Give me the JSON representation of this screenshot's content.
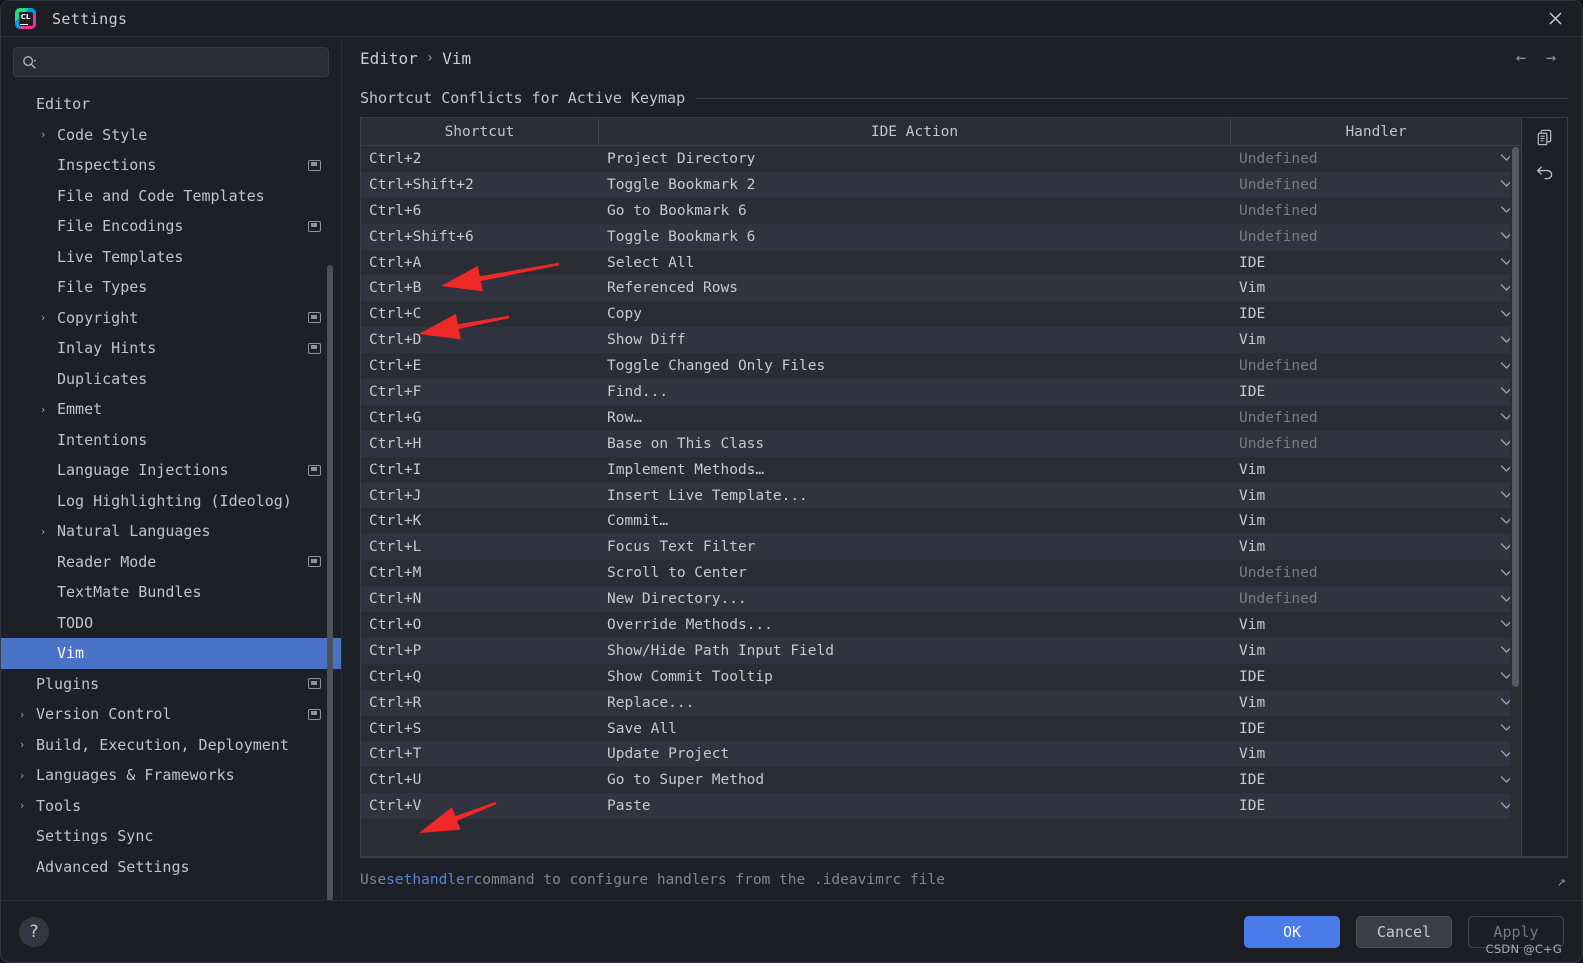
{
  "window": {
    "title": "Settings",
    "app_icon": "clion-icon",
    "close_icon": "close-icon"
  },
  "search": {
    "placeholder": "",
    "value": "",
    "icon": "search-icon"
  },
  "sidebar": {
    "root_label": "Editor",
    "items": [
      {
        "label": "Code Style",
        "level": 1,
        "expandable": true,
        "badge": false
      },
      {
        "label": "Inspections",
        "level": 1,
        "expandable": false,
        "badge": true
      },
      {
        "label": "File and Code Templates",
        "level": 1,
        "expandable": false,
        "badge": false
      },
      {
        "label": "File Encodings",
        "level": 1,
        "expandable": false,
        "badge": true
      },
      {
        "label": "Live Templates",
        "level": 1,
        "expandable": false,
        "badge": false
      },
      {
        "label": "File Types",
        "level": 1,
        "expandable": false,
        "badge": false
      },
      {
        "label": "Copyright",
        "level": 1,
        "expandable": true,
        "badge": true
      },
      {
        "label": "Inlay Hints",
        "level": 1,
        "expandable": false,
        "badge": true
      },
      {
        "label": "Duplicates",
        "level": 1,
        "expandable": false,
        "badge": false
      },
      {
        "label": "Emmet",
        "level": 1,
        "expandable": true,
        "badge": false
      },
      {
        "label": "Intentions",
        "level": 1,
        "expandable": false,
        "badge": false
      },
      {
        "label": "Language Injections",
        "level": 1,
        "expandable": false,
        "badge": true
      },
      {
        "label": "Log Highlighting (Ideolog)",
        "level": 1,
        "expandable": false,
        "badge": false
      },
      {
        "label": "Natural Languages",
        "level": 1,
        "expandable": true,
        "badge": false
      },
      {
        "label": "Reader Mode",
        "level": 1,
        "expandable": false,
        "badge": true
      },
      {
        "label": "TextMate Bundles",
        "level": 1,
        "expandable": false,
        "badge": false
      },
      {
        "label": "TODO",
        "level": 1,
        "expandable": false,
        "badge": false
      },
      {
        "label": "Vim",
        "level": 1,
        "expandable": false,
        "badge": false,
        "selected": true
      },
      {
        "label": "Plugins",
        "level": 0,
        "expandable": false,
        "badge": true
      },
      {
        "label": "Version Control",
        "level": 0,
        "expandable": true,
        "badge": true
      },
      {
        "label": "Build, Execution, Deployment",
        "level": 0,
        "expandable": true,
        "badge": false
      },
      {
        "label": "Languages & Frameworks",
        "level": 0,
        "expandable": true,
        "badge": false
      },
      {
        "label": "Tools",
        "level": 0,
        "expandable": true,
        "badge": false
      },
      {
        "label": "Settings Sync",
        "level": 0,
        "expandable": false,
        "badge": false
      },
      {
        "label": "Advanced Settings",
        "level": 0,
        "expandable": false,
        "badge": false
      }
    ]
  },
  "breadcrumb": {
    "parent": "Editor",
    "separator": "›",
    "current": "Vim",
    "back_icon": "arrow-left-icon",
    "forward_icon": "arrow-right-icon"
  },
  "main": {
    "section_title": "Shortcut Conflicts for Active Keymap",
    "columns": [
      "Shortcut",
      "IDE Action",
      "Handler"
    ],
    "rows": [
      {
        "shortcut": "Ctrl+2",
        "action": "Project Directory",
        "handler": "Undefined"
      },
      {
        "shortcut": "Ctrl+Shift+2",
        "action": "Toggle Bookmark 2",
        "handler": "Undefined"
      },
      {
        "shortcut": "Ctrl+6",
        "action": "Go to Bookmark 6",
        "handler": "Undefined"
      },
      {
        "shortcut": "Ctrl+Shift+6",
        "action": "Toggle Bookmark 6",
        "handler": "Undefined"
      },
      {
        "shortcut": "Ctrl+A",
        "action": "Select All",
        "handler": "IDE"
      },
      {
        "shortcut": "Ctrl+B",
        "action": "Referenced Rows",
        "handler": "Vim"
      },
      {
        "shortcut": "Ctrl+C",
        "action": "Copy",
        "handler": "IDE"
      },
      {
        "shortcut": "Ctrl+D",
        "action": "Show Diff",
        "handler": "Vim"
      },
      {
        "shortcut": "Ctrl+E",
        "action": "Toggle Changed Only Files",
        "handler": "Undefined"
      },
      {
        "shortcut": "Ctrl+F",
        "action": "Find...",
        "handler": "IDE"
      },
      {
        "shortcut": "Ctrl+G",
        "action": "Row…",
        "handler": "Undefined"
      },
      {
        "shortcut": "Ctrl+H",
        "action": "Base on This Class",
        "handler": "Undefined"
      },
      {
        "shortcut": "Ctrl+I",
        "action": "Implement Methods…",
        "handler": "Vim"
      },
      {
        "shortcut": "Ctrl+J",
        "action": "Insert Live Template...",
        "handler": "Vim"
      },
      {
        "shortcut": "Ctrl+K",
        "action": "Commit…",
        "handler": "Vim"
      },
      {
        "shortcut": "Ctrl+L",
        "action": "Focus Text Filter",
        "handler": "Vim"
      },
      {
        "shortcut": "Ctrl+M",
        "action": "Scroll to Center",
        "handler": "Undefined"
      },
      {
        "shortcut": "Ctrl+N",
        "action": "New Directory...",
        "handler": "Undefined"
      },
      {
        "shortcut": "Ctrl+O",
        "action": "Override Methods...",
        "handler": "Vim"
      },
      {
        "shortcut": "Ctrl+P",
        "action": "Show/Hide Path Input Field",
        "handler": "Vim"
      },
      {
        "shortcut": "Ctrl+Q",
        "action": "Show Commit Tooltip",
        "handler": "IDE"
      },
      {
        "shortcut": "Ctrl+R",
        "action": "Replace...",
        "handler": "Vim"
      },
      {
        "shortcut": "Ctrl+S",
        "action": "Save All",
        "handler": "IDE"
      },
      {
        "shortcut": "Ctrl+T",
        "action": "Update Project",
        "handler": "Vim"
      },
      {
        "shortcut": "Ctrl+U",
        "action": "Go to Super Method",
        "handler": "IDE"
      },
      {
        "shortcut": "Ctrl+V",
        "action": "Paste",
        "handler": "IDE"
      }
    ],
    "tools": [
      {
        "icon": "copy-icon"
      },
      {
        "icon": "revert-icon"
      }
    ],
    "note_prefix": "Use ",
    "note_link": "sethandler",
    "note_suffix": " command to configure handlers from the .ideavimrc file",
    "expand_icon": "expand-icon"
  },
  "footer": {
    "help_icon": "?",
    "ok_label": "OK",
    "cancel_label": "Cancel",
    "apply_label": "Apply",
    "watermark": "CSDN @C+G"
  },
  "annotations": {
    "arrow_color": "#f02828",
    "arrows": [
      {
        "target": "Ctrl+A"
      },
      {
        "target": "Ctrl+C"
      },
      {
        "target": "Ctrl+V"
      }
    ]
  },
  "colors": {
    "accent": "#4a7ae8",
    "selection": "#4a73c8",
    "panel": "#1e2027",
    "row_odd": "#2b2d35",
    "row_even": "#313440",
    "link": "#5a84d8"
  }
}
